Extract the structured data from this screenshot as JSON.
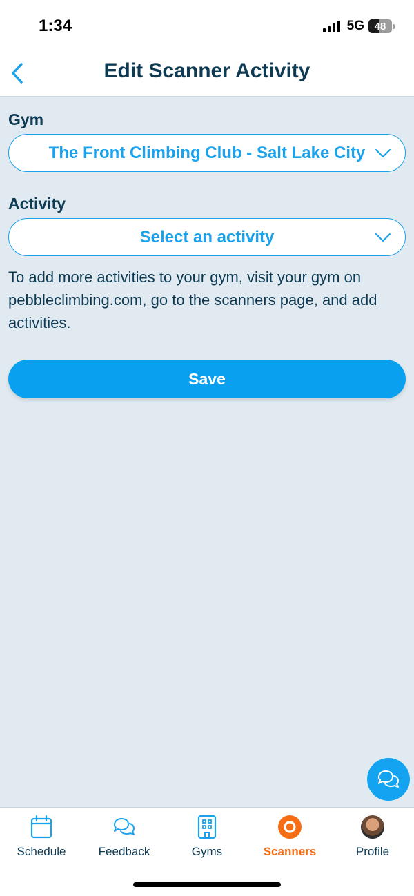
{
  "status_bar": {
    "time": "1:34",
    "network": "5G",
    "battery": "48",
    "battery_level": 0.48
  },
  "header": {
    "title": "Edit Scanner Activity",
    "back_icon": "chevron-left-icon"
  },
  "form": {
    "gym_label": "Gym",
    "gym_value": "The Front Climbing Club - Salt Lake City",
    "activity_label": "Activity",
    "activity_value": "Select an activity",
    "help_text": "To add more activities to your gym, visit your gym on pebbleclimbing.com, go to the scanners page, and add activities.",
    "save_label": "Save"
  },
  "chat_button": {
    "icon": "chat-bubbles-icon"
  },
  "tabs": [
    {
      "label": "Schedule",
      "icon": "calendar-icon",
      "active": false
    },
    {
      "label": "Feedback",
      "icon": "chat-bubbles-icon",
      "active": false
    },
    {
      "label": "Gyms",
      "icon": "building-icon",
      "active": false
    },
    {
      "label": "Scanners",
      "icon": "scanner-icon",
      "active": true
    },
    {
      "label": "Profile",
      "icon": "avatar",
      "active": false
    }
  ],
  "colors": {
    "accent": "#1aa2ec",
    "active_tab": "#f66d14",
    "text_dark": "#0e3b53",
    "background": "#e1eaf1"
  }
}
